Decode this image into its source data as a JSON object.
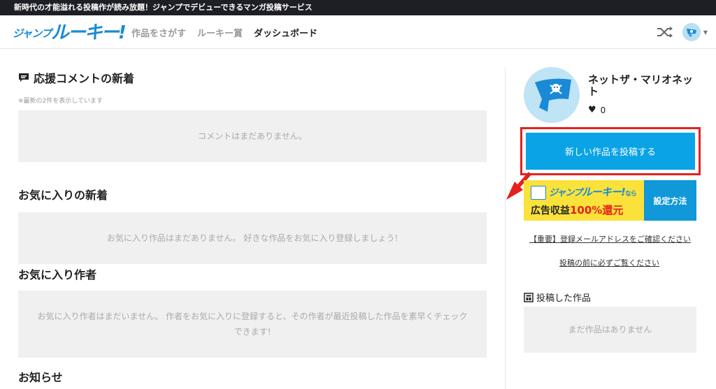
{
  "topbar": {
    "text": "新時代の才能溢れる投稿作が読み放題！ジャンプでデビューできるマンガ投稿サービス"
  },
  "header": {
    "logo_jump": "ジャンプ",
    "logo_rookie": "ルーキー!",
    "nav": [
      {
        "label": "作品をさがす"
      },
      {
        "label": "ルーキー賞"
      },
      {
        "label": "ダッシュボード"
      }
    ],
    "icons": [
      "shuffle-icon",
      "user-avatar-icon",
      "caret-down-icon"
    ]
  },
  "main": {
    "comments": {
      "title": "応援コメントの新着",
      "note": "※最新の2件を表示しています",
      "empty": "コメントはまだありません。"
    },
    "favorites": {
      "title": "お気に入りの新着",
      "empty": "お気に入り作品はまだありません。 好きな作品をお気に入り登録しましょう!"
    },
    "favorite_authors": {
      "title": "お気に入り作者",
      "empty": "お気に入り作者はまだいません。 作者をお気に入りに登録すると、その作者が最近投稿した作品を素早くチェックできます!"
    },
    "news": {
      "title": "お知らせ"
    }
  },
  "sidebar": {
    "profile": {
      "name": "ネットザ・マリオネット",
      "likes": "0"
    },
    "post_button": "新しい作品を投稿する",
    "banner": {
      "logo_jump": "ジャンプ",
      "logo_rookie": "ルーキー!",
      "logo_suffix": "なら",
      "ad_text": "広告収益",
      "ad_percent": "100%還元",
      "settings": "設定方法"
    },
    "links": [
      {
        "label": "【重要】登録メールアドレスをご確認ください"
      },
      {
        "label": "投稿の前に必ずご覧ください"
      }
    ],
    "works": {
      "title": "投稿した作品",
      "empty": "まだ作品はありません"
    }
  },
  "colors": {
    "accent": "#0aa3e6",
    "highlight": "#e52020",
    "banner_yellow": "#fbe23a",
    "topbar": "#1e1e26"
  }
}
